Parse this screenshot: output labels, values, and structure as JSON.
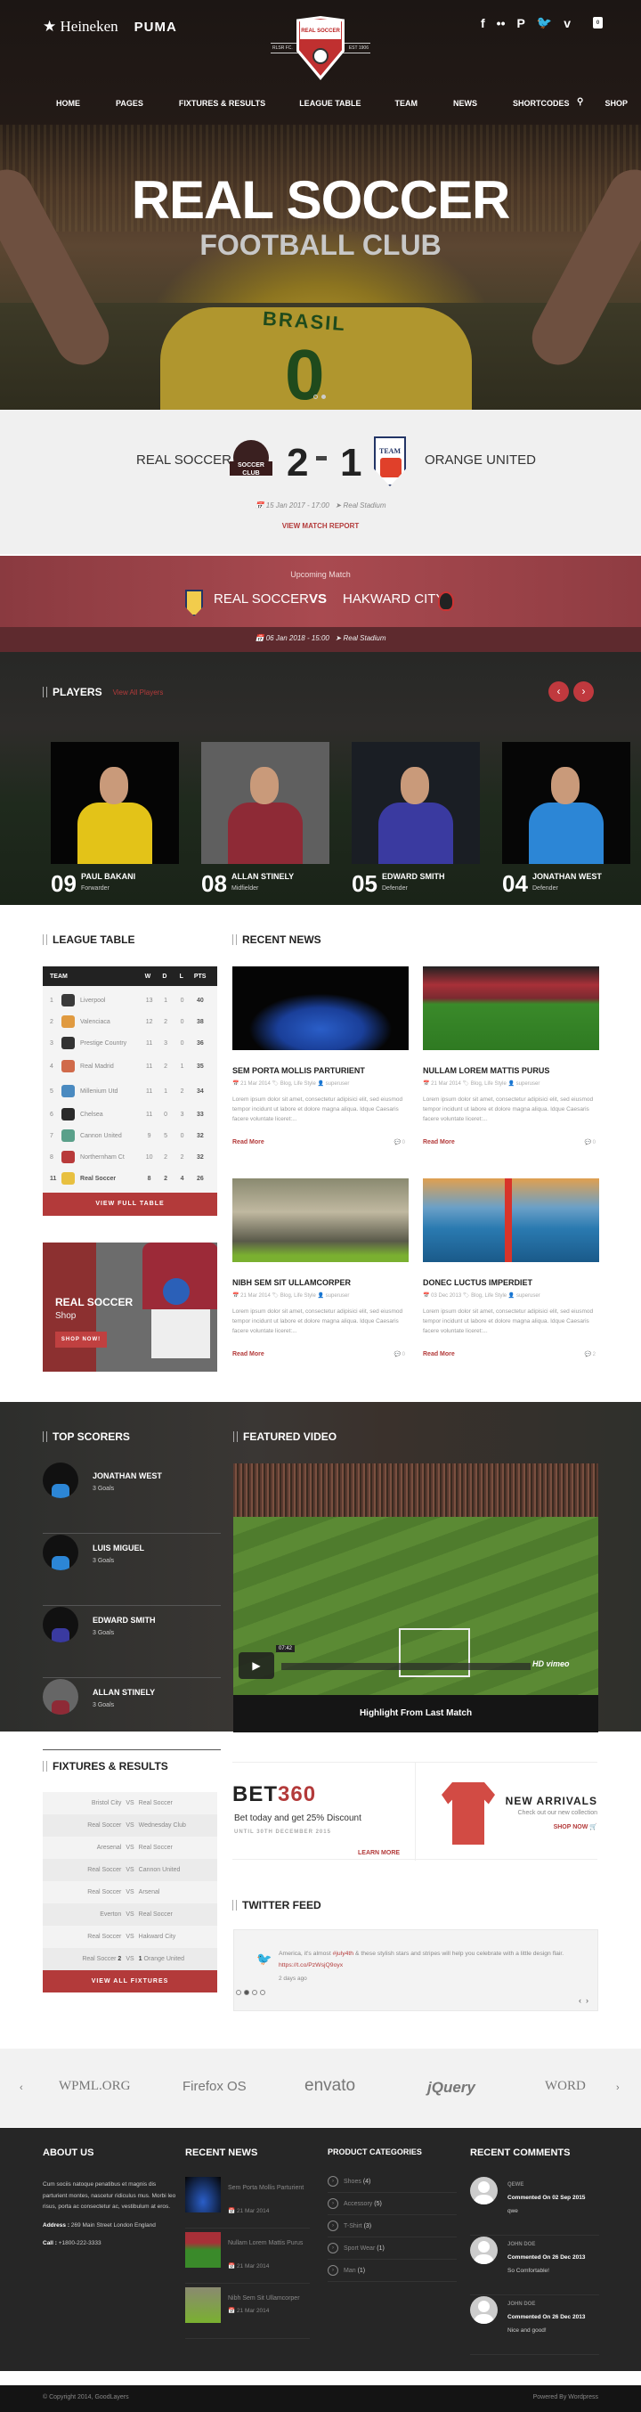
{
  "header": {
    "sponsors": [
      "★ Heineken",
      "PUMA"
    ],
    "logo": {
      "name": "REAL SOCCER",
      "left_tag": "RLSR FC.",
      "right_tag": "EST 1906"
    },
    "social_icons": [
      "facebook-icon",
      "flickr-icon",
      "pinterest-icon",
      "twitter-icon",
      "vimeo-icon"
    ],
    "social_glyphs": [
      "f",
      "••",
      "P",
      "t",
      "v"
    ],
    "cart_count": "0",
    "nav": [
      "HOME",
      "PAGES",
      "FIXTURES & RESULTS",
      "LEAGUE TABLE",
      "TEAM",
      "NEWS",
      "SHORTCODES",
      "SHOP"
    ],
    "search_glyph": "🔍"
  },
  "hero": {
    "title": "REAL SOCCER",
    "subtitle": "FOOTBALL CLUB",
    "jersey_text": "BRASIL",
    "jersey_number": "0",
    "slides": 2,
    "active_slide": 1
  },
  "last_match": {
    "home": "REAL SOCCER",
    "away": "ORANGE UNITED",
    "home_score": "2",
    "away_score": "1",
    "home_badge_text": "SOCCER CLUB",
    "away_badge_text": "TEAM",
    "date": "15 Jan 2017 - 17:00",
    "venue": "Real Stadium",
    "report_link": "VIEW MATCH REPORT"
  },
  "upcoming": {
    "label": "Upcoming Match",
    "home": "REAL SOCCER",
    "vs": "VS",
    "away": "HAKWARD CITY",
    "date": "06 Jan 2018 - 15:00",
    "venue": "Real Stadium"
  },
  "players": {
    "title": "PLAYERS",
    "view_all": "View All Players",
    "prev": "‹",
    "next": "›",
    "items": [
      {
        "number": "09",
        "name": "PAUL BAKANI",
        "position": "Forwarder",
        "kit": "#e3c318",
        "bg": "#050505"
      },
      {
        "number": "08",
        "name": "ALLAN STINELY",
        "position": "Midfielder",
        "kit": "#8e2a36",
        "bg": "#5f5f5f"
      },
      {
        "number": "05",
        "name": "EDWARD SMITH",
        "position": "Defender",
        "kit": "#3a3aa0",
        "bg": "#1a1e24"
      },
      {
        "number": "04",
        "name": "JONATHAN WEST",
        "position": "Defender",
        "kit": "#2c86d6",
        "bg": "#060606"
      }
    ]
  },
  "league_table": {
    "title": "LEAGUE TABLE",
    "columns": [
      "TEAM",
      "W",
      "D",
      "L",
      "PTS"
    ],
    "rows": [
      {
        "rank": "1",
        "team": "Liverpool",
        "w": "13",
        "d": "1",
        "l": "0",
        "pts": "40",
        "crest": "#3a3a3a"
      },
      {
        "rank": "2",
        "team": "Valenciaca",
        "w": "12",
        "d": "2",
        "l": "0",
        "pts": "38",
        "crest": "#e09a40"
      },
      {
        "rank": "3",
        "team": "Prestige Country",
        "w": "11",
        "d": "3",
        "l": "0",
        "pts": "36",
        "crest": "#333"
      },
      {
        "rank": "4",
        "team": "Real Madrid",
        "w": "11",
        "d": "2",
        "l": "1",
        "pts": "35",
        "crest": "#d06a4a"
      },
      {
        "rank": "5",
        "team": "Millenium Utd",
        "w": "11",
        "d": "1",
        "l": "2",
        "pts": "34",
        "crest": "#4a8ac0"
      },
      {
        "rank": "6",
        "team": "Chelsea",
        "w": "11",
        "d": "0",
        "l": "3",
        "pts": "33",
        "crest": "#2a2a2a"
      },
      {
        "rank": "7",
        "team": "Cannon United",
        "w": "9",
        "d": "5",
        "l": "0",
        "pts": "32",
        "crest": "#5aa08a"
      },
      {
        "rank": "8",
        "team": "Northernham Ct",
        "w": "10",
        "d": "2",
        "l": "2",
        "pts": "32",
        "crest": "#b83a3a"
      },
      {
        "rank": "11",
        "team": "Real Soccer",
        "w": "8",
        "d": "2",
        "l": "4",
        "pts": "26",
        "crest": "#e8c040",
        "highlight": true
      }
    ],
    "button": "VIEW FULL TABLE"
  },
  "shop_banner": {
    "title": "REAL SOCCER",
    "subtitle": "Shop",
    "button": "SHOP NOW!"
  },
  "recent_news": {
    "title": "RECENT NEWS",
    "items": [
      {
        "title": "SEM PORTA MOLLIS PARTURIENT",
        "date": "21 Mar 2014",
        "tags": "Blog, Life Style",
        "author": "superuser",
        "excerpt": "Lorem ipsum dolor sit amet, consectetur adipisici elit, sed eiusmod tempor incidunt ut labore et dolore magna aliqua. Idque Caesaris facere voluntate liceret:...",
        "read_more": "Read More",
        "comments": "0",
        "img": "team"
      },
      {
        "title": "NULLAM LOREM MATTIS PURUS",
        "date": "21 Mar 2014",
        "tags": "Blog, Life Style",
        "author": "superuser",
        "excerpt": "Lorem ipsum dolor sit amet, consectetur adipisici elit, sed eiusmod tempor incidunt ut labore et dolore magna aliqua. Idque Caesaris facere voluntate liceret:...",
        "read_more": "Read More",
        "comments": "0",
        "img": "stadium"
      },
      {
        "title": "NIBH SEM SIT ULLAMCORPER",
        "date": "21 Mar 2014",
        "tags": "Blog, Life Style",
        "author": "superuser",
        "excerpt": "Lorem ipsum dolor sit amet, consectetur adipisici elit, sed eiusmod tempor incidunt ut labore et dolore magna aliqua. Idque Caesaris facere voluntate liceret:...",
        "read_more": "Read More",
        "comments": "0",
        "img": "kick"
      },
      {
        "title": "DONEC LUCTUS IMPERDIET",
        "date": "03 Dec 2013",
        "tags": "Blog, Life Style",
        "author": "superuser",
        "excerpt": "Lorem ipsum dolor sit amet, consectetur adipisici elit, sed eiusmod tempor incidunt ut labore et dolore magna aliqua. Idque Caesaris facere voluntate liceret:...",
        "read_more": "Read More",
        "comments": "2",
        "img": "bridge"
      }
    ]
  },
  "top_scorers": {
    "title": "TOP SCORERS",
    "items": [
      {
        "name": "JONATHAN WEST",
        "goals": "3 Goals",
        "kit": "#2c86d6"
      },
      {
        "name": "LUIS MIGUEL",
        "goals": "3 Goals",
        "kit": "#2c86d6"
      },
      {
        "name": "EDWARD SMITH",
        "goals": "3 Goals",
        "kit": "#3a3aa0"
      },
      {
        "name": "ALLAN STINELY",
        "goals": "3 Goals",
        "kit": "#8e2a36"
      }
    ]
  },
  "featured_video": {
    "title": "FEATURED VIDEO",
    "time": "07:42",
    "provider": "HD vimeo",
    "caption": "Highlight From Last Match"
  },
  "fixtures": {
    "title": "FIXTURES & RESULTS",
    "rows": [
      {
        "home": "Bristol City",
        "away": "Real Soccer",
        "hs": "",
        "as": ""
      },
      {
        "home": "Real Soccer",
        "away": "Wednesday Club",
        "hs": "",
        "as": ""
      },
      {
        "home": "Aresenal",
        "away": "Real Soccer",
        "hs": "",
        "as": ""
      },
      {
        "home": "Real Soccer",
        "away": "Cannon United",
        "hs": "",
        "as": ""
      },
      {
        "home": "Real Soccer",
        "away": "Arsenal",
        "hs": "",
        "as": ""
      },
      {
        "home": "Everton",
        "away": "Real Soccer",
        "hs": "",
        "as": ""
      },
      {
        "home": "Real Soccer",
        "away": "Hakward City",
        "hs": "",
        "as": ""
      },
      {
        "home": "Real Soccer",
        "away": "Orange United",
        "hs": "2",
        "as": "1"
      }
    ],
    "vs": "VS",
    "button": "VIEW ALL FIXTURES"
  },
  "promo": {
    "bet_brand_a": "BET",
    "bet_brand_b": "360",
    "bet_text": "Bet today and get 25% Discount",
    "bet_until": "UNTIL 30TH DECEMBER 2015",
    "bet_link": "LEARN MORE",
    "arrivals_title": "NEW ARRIVALS",
    "arrivals_text": "Check out our new collection",
    "arrivals_link": "SHOP NOW 🛒"
  },
  "twitter": {
    "title": "TWITTER FEED",
    "text_a": "America, it's almost ",
    "hashtag": "#july4th",
    "text_b": " & these stylish stars and stripes will help you celebrate with a little design flair. ",
    "link": "https://t.co/PzWsjQ9oyx",
    "time": "2 days ago",
    "pages": 4,
    "active_page": 2
  },
  "clients": {
    "items": [
      "WPML.ORG",
      "Firefox OS",
      "envato",
      "jQuery",
      "WORD"
    ],
    "prev": "‹",
    "next": "›"
  },
  "footer": {
    "about": {
      "title": "ABOUT US",
      "text": "Cum sociis natoque penatibus et magnis dis parturient montes, nascetur ridiculus mus. Morbi leo risus, porta ac consectetur ac, vestibulum at eros.",
      "address_label": "Address :",
      "address": "269 Main Street London England",
      "call_label": "Call :",
      "call": "+1800-222-3333"
    },
    "news": {
      "title": "RECENT NEWS",
      "items": [
        {
          "title": "Sem Porta Mollis Parturient",
          "date": "21 Mar 2014"
        },
        {
          "title": "Nullam Lorem Mattis Purus",
          "date": "21 Mar 2014"
        },
        {
          "title": "Nibh Sem Sit Ullamcorper",
          "date": "21 Mar 2014"
        }
      ]
    },
    "categories": {
      "title": "PRODUCT CATEGORIES",
      "items": [
        {
          "name": "Shoes",
          "count": "(4)"
        },
        {
          "name": "Accessory",
          "count": "(5)"
        },
        {
          "name": "T-Shirt",
          "count": "(3)"
        },
        {
          "name": "Sport Wear",
          "count": "(1)"
        },
        {
          "name": "Man",
          "count": "(1)"
        }
      ]
    },
    "comments": {
      "title": "RECENT COMMENTS",
      "items": [
        {
          "author": "QEWE",
          "on": "Commented On 02 Sep 2015",
          "text": "qwe"
        },
        {
          "author": "JOHN DOE",
          "on": "Commented On 26 Dec 2013",
          "text": "So Comfortable!"
        },
        {
          "author": "JOHN DOE",
          "on": "Commented On 26 Dec 2013",
          "text": "Nice and good!"
        }
      ]
    },
    "copyright": "© Copyright 2014, GoodLayers",
    "powered": "Powered By Wordpress"
  },
  "colors": {
    "accent": "#b33a3a",
    "dark": "#262626",
    "footer_bottom": "#141414",
    "light_bg": "#f0f0f0"
  }
}
